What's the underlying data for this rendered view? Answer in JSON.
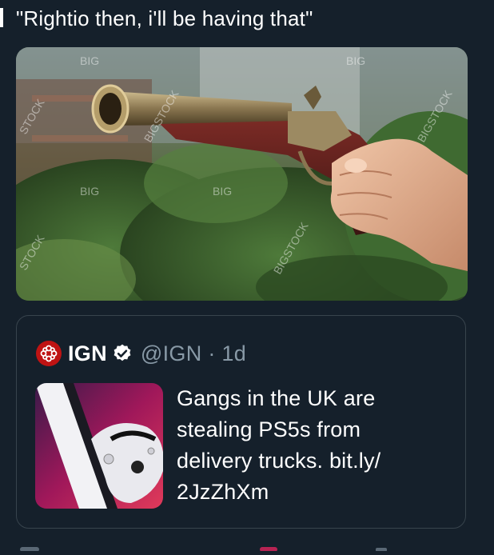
{
  "tweet": {
    "text": "\"Rightio then, i'll be having that\""
  },
  "media": {
    "watermark": "BIGSTOCK",
    "watermark_short": "BIG",
    "watermark_stock": "STOCK"
  },
  "quote": {
    "display_name": "IGN",
    "handle_time": "@IGN · 1d",
    "body_lines": [
      "Gangs in the UK are",
      "stealing PS5s from",
      "delivery trucks. bit.ly/",
      "2JzZhXm"
    ]
  },
  "colors": {
    "background": "#15202b",
    "border": "#38444d",
    "secondary_text": "#8899a6",
    "ign_red": "#bf1313",
    "verified_fill": "#ffffff"
  }
}
